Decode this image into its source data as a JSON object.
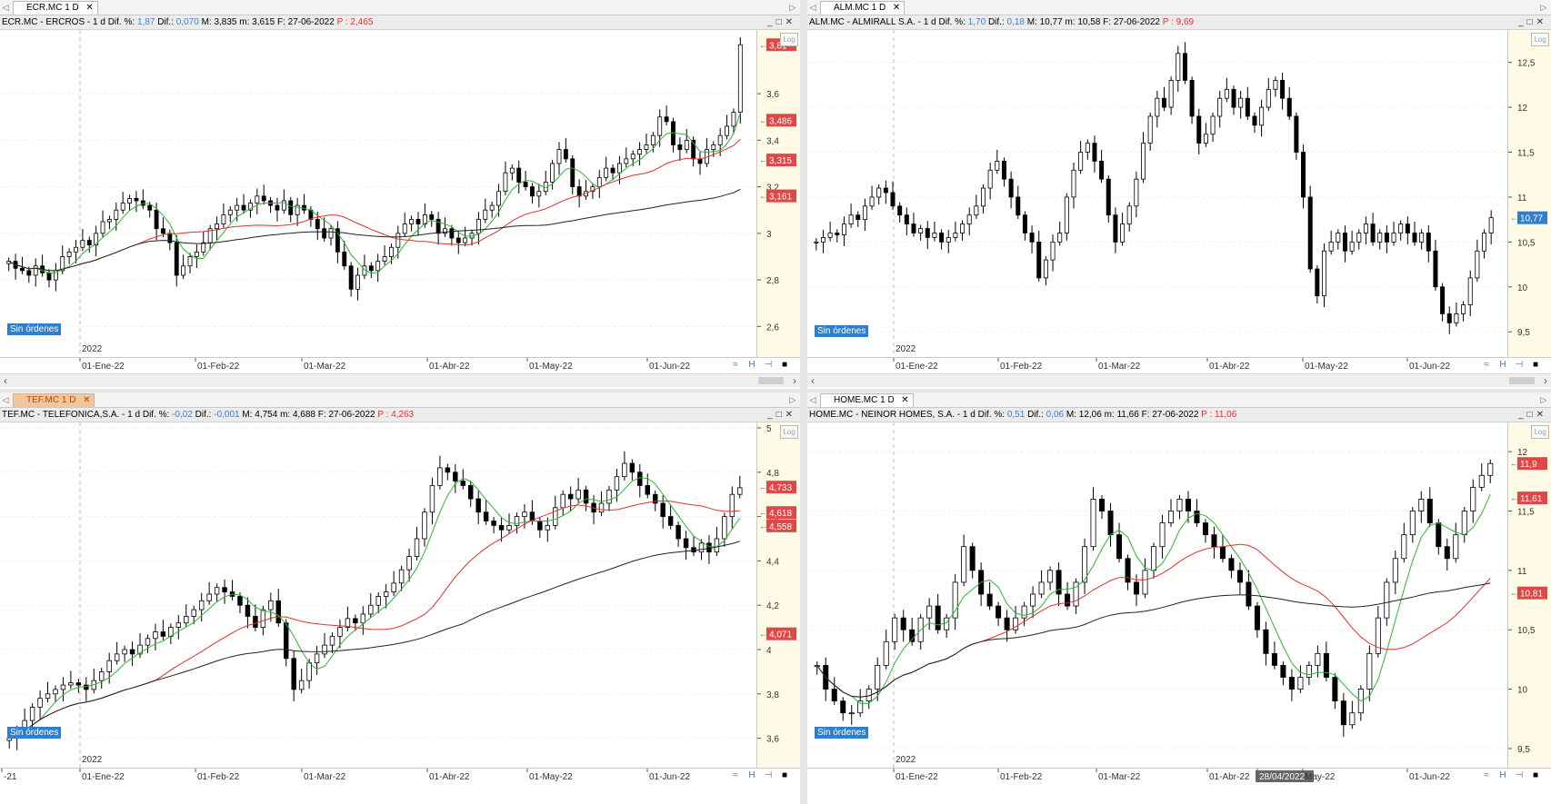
{
  "panes": [
    {
      "id": "ecr",
      "tab": "ECR.MC 1 D",
      "tab_active": false,
      "info": {
        "name": "ECR.MC - ERCROS -",
        "tf": "1 d",
        "dif_pct_label": "Dif. %:",
        "dif_pct": "1,87",
        "dif_label": "Dif.:",
        "dif": "0,070",
        "m_label": "M:",
        "m": "3,835",
        "mn_label": "m:",
        "mn": "3,615",
        "f_label": "F:",
        "f": "27-06-2022",
        "p_label": "P :",
        "p": "2,465"
      },
      "badge": "Sin órdenes",
      "year_label": "2022",
      "date_labels": [
        "01-Ene-22",
        "01-Feb-22",
        "01-Mar-22",
        "01-Abr-22",
        "01-May-22",
        "01-Jun-22"
      ],
      "y_ticks": [
        "3,6",
        "3,4",
        "3,2",
        "3",
        "2,8",
        "2,6"
      ],
      "price_tags": [
        "3,81",
        "3,486",
        "3,315",
        "3,161"
      ],
      "tag_colors": [
        "#e04848",
        "#e04848",
        "#e04848",
        "#e04848"
      ],
      "log_label": "Log",
      "chart_data": {
        "type": "candlestick",
        "ylim": [
          2.5,
          3.85
        ],
        "y_tick_values": [
          3.6,
          3.4,
          3.2,
          3.0,
          2.8,
          2.6
        ],
        "price_tag_values": [
          3.81,
          3.486,
          3.315,
          3.161
        ],
        "series": [
          {
            "name": "",
            "kind": "candles",
            "close": [
              2.88,
              2.85,
              2.84,
              2.82,
              2.86,
              2.83,
              2.8,
              2.84,
              2.9,
              2.92,
              2.94,
              2.97,
              2.95,
              3.0,
              3.05,
              3.06,
              3.1,
              3.13,
              3.15,
              3.14,
              3.12,
              3.1,
              3.02,
              3.0,
              2.96,
              2.82,
              2.86,
              2.9,
              2.92,
              2.96,
              3.02,
              3.04,
              3.08,
              3.1,
              3.12,
              3.1,
              3.13,
              3.16,
              3.14,
              3.12,
              3.1,
              3.14,
              3.08,
              3.12,
              3.1,
              3.06,
              3.02,
              2.98,
              3.02,
              2.92,
              2.86,
              2.76,
              2.82,
              2.86,
              2.84,
              2.88,
              2.9,
              2.94,
              3.0,
              3.04,
              3.06,
              3.04,
              3.08,
              3.06,
              3.0,
              3.02,
              2.98,
              2.96,
              2.98,
              3.0,
              3.06,
              3.1,
              3.12,
              3.18,
              3.26,
              3.28,
              3.22,
              3.2,
              3.16,
              3.18,
              3.22,
              3.3,
              3.36,
              3.32,
              3.2,
              3.16,
              3.18,
              3.2,
              3.24,
              3.28,
              3.26,
              3.3,
              3.32,
              3.34,
              3.36,
              3.38,
              3.42,
              3.5,
              3.48,
              3.38,
              3.36,
              3.4,
              3.32,
              3.3,
              3.36,
              3.38,
              3.42,
              3.46,
              3.52,
              3.81
            ]
          },
          {
            "name": "",
            "kind": "ma_fast",
            "color": "#2fb52f"
          },
          {
            "name": "",
            "kind": "ma_mid",
            "color": "#e03030"
          },
          {
            "name": "",
            "kind": "ma_slow",
            "color": "#222222"
          }
        ]
      }
    },
    {
      "id": "alm",
      "tab": "ALM.MC 1 D",
      "tab_active": false,
      "info": {
        "name": "ALM.MC - ALMIRALL S.A. -",
        "tf": "1 d",
        "dif_pct_label": "Dif. %:",
        "dif_pct": "1,70",
        "dif_label": "Dif.:",
        "dif": "0,18",
        "m_label": "M:",
        "m": "10,77",
        "mn_label": "m:",
        "mn": "10,58",
        "f_label": "F:",
        "f": "27-06-2022",
        "p_label": "P :",
        "p": "9,69"
      },
      "badge": "Sin órdenes",
      "year_label": "2022",
      "date_labels": [
        "01-Ene-22",
        "01-Feb-22",
        "01-Mar-22",
        "01-Abr-22",
        "01-May-22",
        "01-Jun-22"
      ],
      "y_ticks": [
        "12,5",
        "12",
        "11,5",
        "11",
        "10,5",
        "10",
        "9,5"
      ],
      "price_tags": [
        "10,77"
      ],
      "tag_colors": [
        "#2f7fd0"
      ],
      "log_label": "Log",
      "chart_data": {
        "type": "candlestick",
        "ylim": [
          9.3,
          12.8
        ],
        "y_tick_values": [
          12.5,
          12,
          11.5,
          11,
          10.5,
          10,
          9.5
        ],
        "price_tag_values": [
          10.77
        ],
        "series": [
          {
            "name": "",
            "kind": "candles",
            "close": [
              10.5,
              10.55,
              10.6,
              10.58,
              10.7,
              10.8,
              10.75,
              10.9,
              11.0,
              11.1,
              11.05,
              10.9,
              10.8,
              10.7,
              10.6,
              10.65,
              10.55,
              10.6,
              10.5,
              10.55,
              10.6,
              10.7,
              10.8,
              10.9,
              11.1,
              11.3,
              11.4,
              11.2,
              11.0,
              10.8,
              10.6,
              10.5,
              10.1,
              10.3,
              10.5,
              10.6,
              11.0,
              11.3,
              11.5,
              11.6,
              11.4,
              11.2,
              10.8,
              10.5,
              10.7,
              10.9,
              11.2,
              11.6,
              11.9,
              12.1,
              12.0,
              12.3,
              12.6,
              12.3,
              11.9,
              11.6,
              11.7,
              11.9,
              12.1,
              12.2,
              12.0,
              12.1,
              11.9,
              11.8,
              12.0,
              12.2,
              12.3,
              12.1,
              11.9,
              11.5,
              11.0,
              10.2,
              9.9,
              10.4,
              10.5,
              10.6,
              10.4,
              10.5,
              10.6,
              10.7,
              10.5,
              10.6,
              10.5,
              10.6,
              10.7,
              10.6,
              10.5,
              10.6,
              10.4,
              10.0,
              9.7,
              9.6,
              9.7,
              9.8,
              10.1,
              10.4,
              10.6,
              10.77
            ]
          }
        ]
      }
    },
    {
      "id": "tef",
      "tab": "TEF.MC 1 D",
      "tab_active": true,
      "info": {
        "name": "TEF.MC - TELEFONICA,S.A. -",
        "tf": "1 d",
        "dif_pct_label": "Dif. %:",
        "dif_pct": "-0,02",
        "dif_label": "Dif.:",
        "dif": "-0,001",
        "m_label": "M:",
        "m": "4,754",
        "mn_label": "m:",
        "mn": "4,688",
        "f_label": "F:",
        "f": "27-06-2022",
        "p_label": "P :",
        "p": "4,263"
      },
      "badge": "Sin órdenes",
      "year_label": "2022",
      "date_labels": [
        "-21",
        "01-Ene-22",
        "01-Feb-22",
        "01-Mar-22",
        "01-Abr-22",
        "01-May-22",
        "01-Jun-22"
      ],
      "y_ticks": [
        "5",
        "4,8",
        "4,6",
        "4,4",
        "4,2",
        "4",
        "3,8",
        "3,6"
      ],
      "price_tags": [
        "4,733",
        "4,618",
        "4,558",
        "4,071"
      ],
      "tag_colors": [
        "#e04848",
        "#e04848",
        "#e04848",
        "#e04848"
      ],
      "log_label": "Log",
      "chart_data": {
        "type": "candlestick",
        "ylim": [
          3.5,
          5.0
        ],
        "y_tick_values": [
          5,
          4.8,
          4.6,
          4.4,
          4.2,
          4.0,
          3.8,
          3.6
        ],
        "price_tag_values": [
          4.733,
          4.618,
          4.558,
          4.071
        ],
        "series": [
          {
            "name": "",
            "kind": "candles",
            "close": [
              3.6,
              3.62,
              3.68,
              3.74,
              3.78,
              3.8,
              3.82,
              3.84,
              3.85,
              3.84,
              3.82,
              3.86,
              3.9,
              3.95,
              3.98,
              4.0,
              3.98,
              4.02,
              4.05,
              4.08,
              4.06,
              4.1,
              4.12,
              4.15,
              4.18,
              4.22,
              4.25,
              4.28,
              4.26,
              4.24,
              4.2,
              4.15,
              4.1,
              4.18,
              4.22,
              4.12,
              3.96,
              3.82,
              3.86,
              3.94,
              3.98,
              4.02,
              4.06,
              4.1,
              4.14,
              4.12,
              4.16,
              4.2,
              4.24,
              4.26,
              4.3,
              4.36,
              4.42,
              4.5,
              4.62,
              4.74,
              4.82,
              4.8,
              4.76,
              4.74,
              4.68,
              4.62,
              4.58,
              4.56,
              4.54,
              4.56,
              4.6,
              4.62,
              4.58,
              4.54,
              4.56,
              4.64,
              4.7,
              4.68,
              4.72,
              4.66,
              4.62,
              4.66,
              4.72,
              4.78,
              4.84,
              4.8,
              4.74,
              4.7,
              4.66,
              4.6,
              4.56,
              4.5,
              4.46,
              4.44,
              4.48,
              4.44,
              4.5,
              4.6,
              4.7,
              4.73
            ]
          },
          {
            "name": "",
            "kind": "ma_fast",
            "color": "#2fb52f"
          },
          {
            "name": "",
            "kind": "ma_mid",
            "color": "#e03030"
          },
          {
            "name": "",
            "kind": "ma_slow",
            "color": "#222222"
          }
        ]
      }
    },
    {
      "id": "home",
      "tab": "HOME.MC 1 D",
      "tab_active": false,
      "info": {
        "name": "HOME.MC - NEINOR HOMES, S.A. -",
        "tf": "1 d",
        "dif_pct_label": "Dif. %:",
        "dif_pct": "0,51",
        "dif_label": "Dif.:",
        "dif": "0,06",
        "m_label": "M:",
        "m": "12,06",
        "mn_label": "m:",
        "mn": "11,66",
        "f_label": "F:",
        "f": "27-06-2022",
        "p_label": "P :",
        "p": "11,06"
      },
      "badge": "Sin órdenes",
      "year_label": "2022",
      "date_labels": [
        "01-Ene-22",
        "01-Feb-22",
        "01-Mar-22",
        "01-Abr-22",
        "28/04/2022",
        "May-22",
        "01-Jun-22"
      ],
      "y_ticks": [
        "12",
        "11,5",
        "11",
        "10,5",
        "10",
        "9,5"
      ],
      "price_tags": [
        "11,9",
        "11,61",
        "10,81"
      ],
      "tag_colors": [
        "#e04848",
        "#e04848",
        "#e04848"
      ],
      "log_label": "Log",
      "chart_data": {
        "type": "candlestick",
        "ylim": [
          9.4,
          12.2
        ],
        "y_tick_values": [
          12,
          11.5,
          11,
          10.5,
          10,
          9.5
        ],
        "price_tag_values": [
          11.9,
          11.61,
          10.81
        ],
        "series": [
          {
            "name": "",
            "kind": "candles",
            "close": [
              10.2,
              10.0,
              9.9,
              9.8,
              9.8,
              9.9,
              10.0,
              10.2,
              10.4,
              10.6,
              10.5,
              10.4,
              10.6,
              10.7,
              10.5,
              10.6,
              10.9,
              11.2,
              11.0,
              10.8,
              10.7,
              10.6,
              10.5,
              10.6,
              10.7,
              10.8,
              10.9,
              11.0,
              10.8,
              10.7,
              10.9,
              11.2,
              11.6,
              11.5,
              11.3,
              11.1,
              10.9,
              10.8,
              11.0,
              11.2,
              11.4,
              11.5,
              11.6,
              11.5,
              11.4,
              11.3,
              11.2,
              11.1,
              11.0,
              10.9,
              10.7,
              10.5,
              10.3,
              10.2,
              10.1,
              10.0,
              10.1,
              10.2,
              10.3,
              10.1,
              9.9,
              9.7,
              9.8,
              10.0,
              10.3,
              10.6,
              10.9,
              11.1,
              11.3,
              11.5,
              11.6,
              11.4,
              11.2,
              11.1,
              11.3,
              11.5,
              11.7,
              11.8,
              11.9
            ]
          },
          {
            "name": "",
            "kind": "ma_fast",
            "color": "#2fb52f"
          },
          {
            "name": "",
            "kind": "ma_mid",
            "color": "#e03030"
          },
          {
            "name": "",
            "kind": "ma_slow",
            "color": "#222222"
          }
        ]
      }
    }
  ]
}
